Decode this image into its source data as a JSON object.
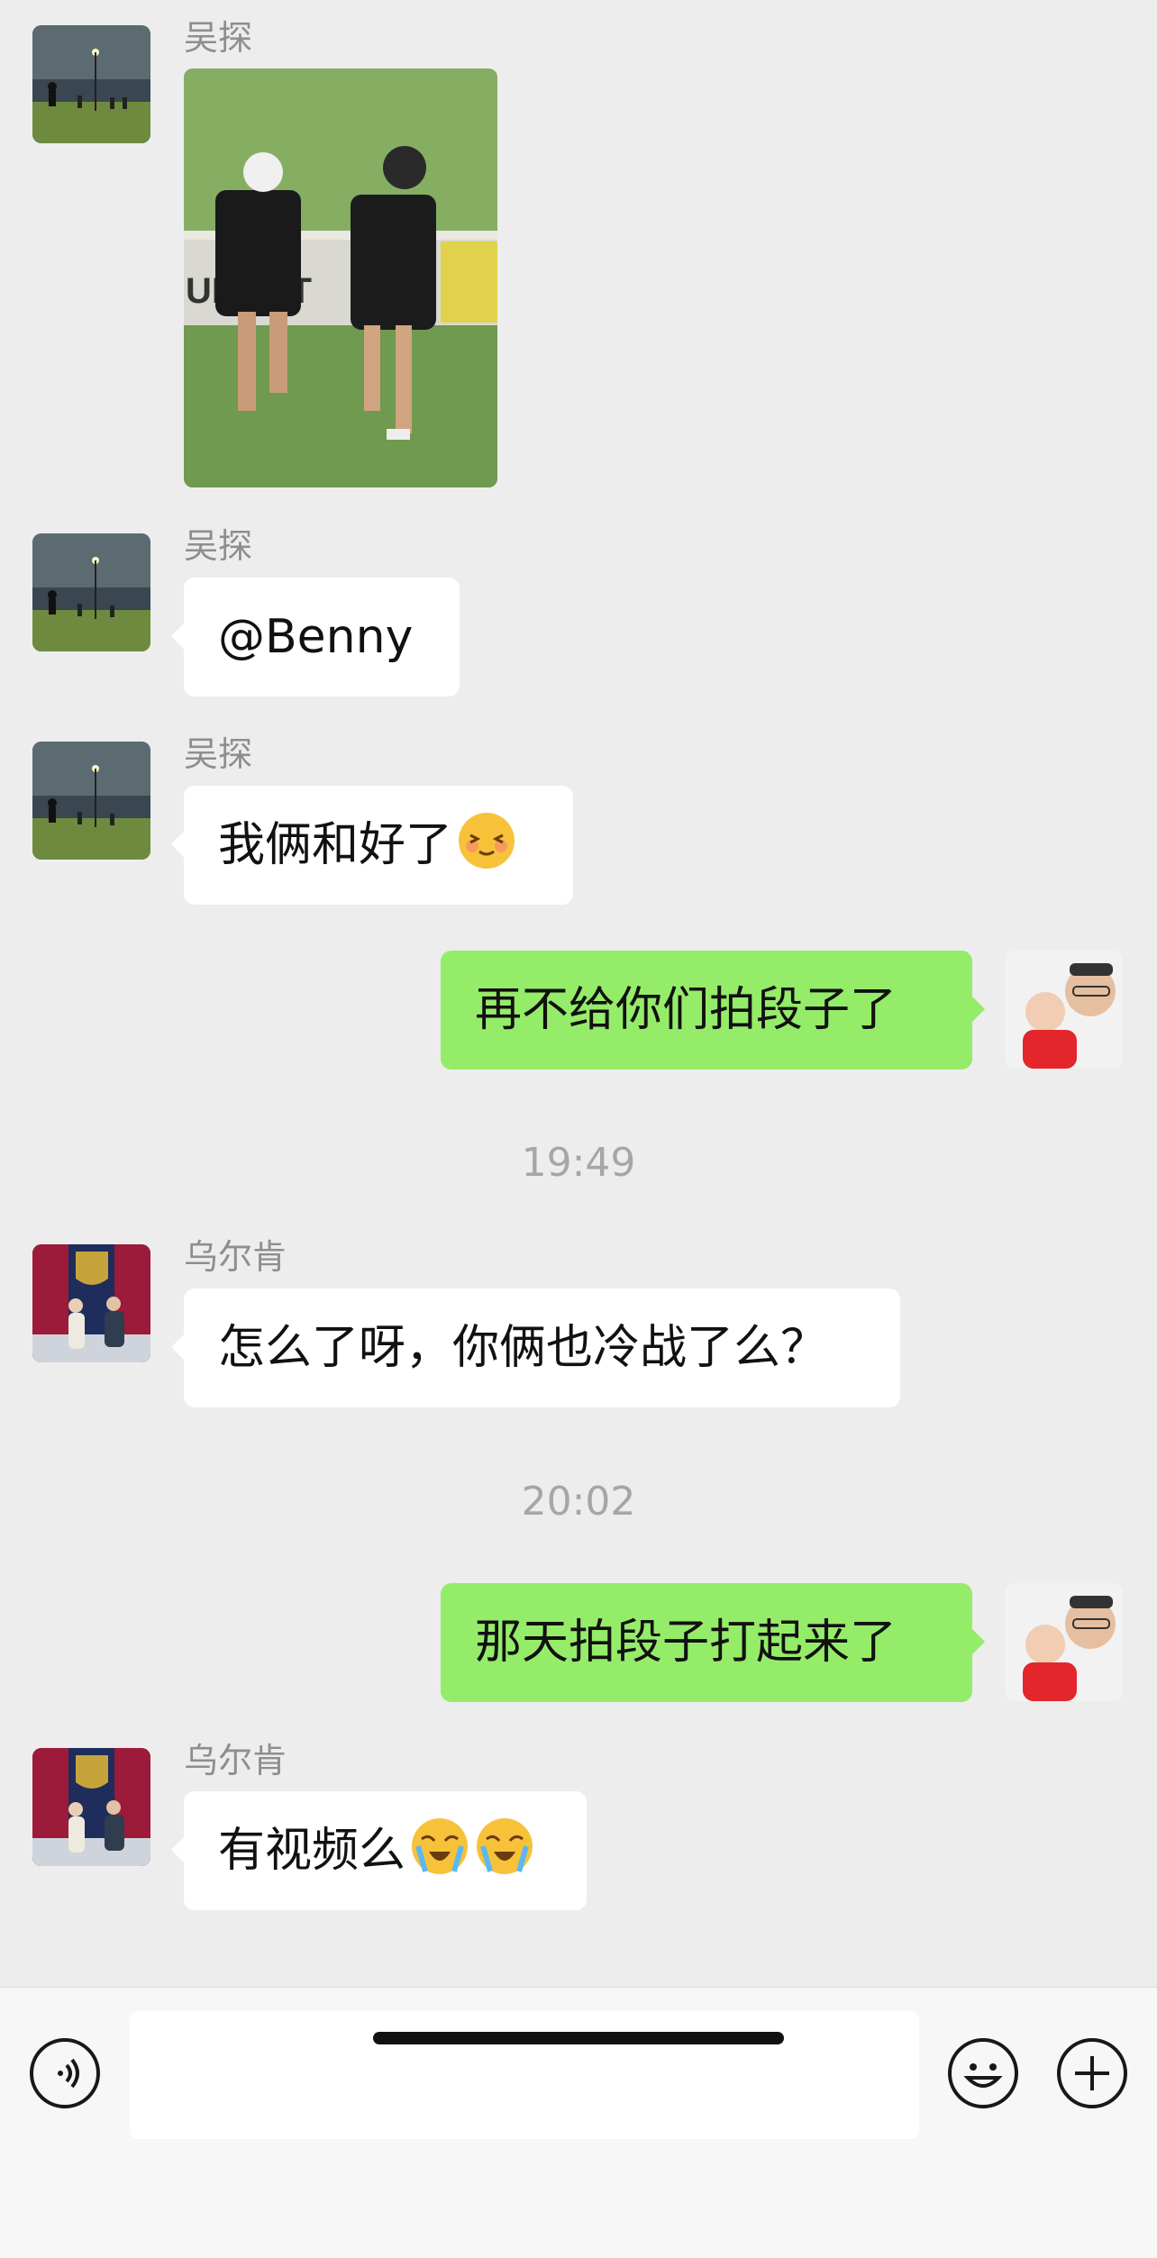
{
  "messages": {
    "m1": {
      "sender": "吴探",
      "type": "image"
    },
    "m2": {
      "sender": "吴探",
      "text": "@Benny"
    },
    "m3": {
      "sender": "吴探",
      "text": "我俩和好了",
      "emoji": "blushing-face"
    },
    "m4": {
      "sender": "me",
      "text": "再不给你们拍段子了"
    },
    "t1": "19:49",
    "m5": {
      "sender": "乌尔肯",
      "text": "怎么了呀，你俩也冷战了么？"
    },
    "t2": "20:02",
    "m6": {
      "sender": "me",
      "text": "那天拍段子打起来了"
    },
    "m7": {
      "sender": "乌尔肯",
      "text": "有视频么",
      "emoji": "loudly-crying-face x2"
    }
  },
  "photo": {
    "banner_text": "UNCNT"
  },
  "input": {
    "value": ""
  },
  "colors": {
    "own_bubble": "#95ec69",
    "other_bubble": "#ffffff",
    "background": "#ededed"
  }
}
